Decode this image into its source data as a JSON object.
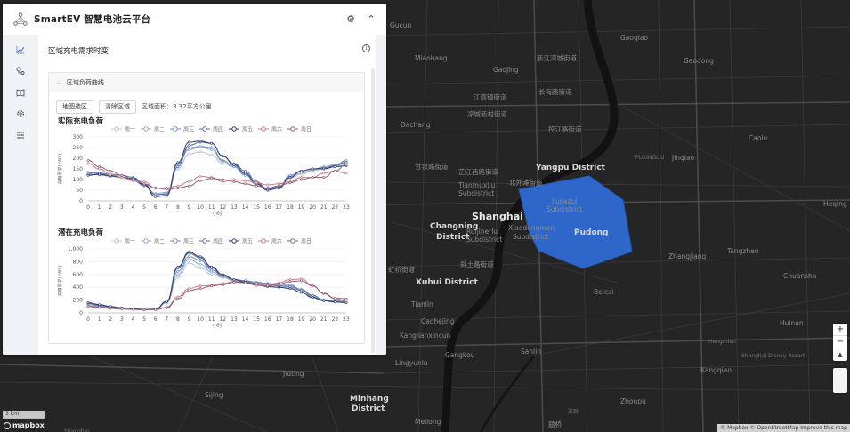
{
  "app": {
    "title": "SmartEV 智慧电池云平台"
  },
  "panel": {
    "section_title": "区域充电需求时变",
    "card_title": "区域负荷曲线",
    "buttons": {
      "select_area": "地图选区",
      "clear_area": "清除区域"
    },
    "area_text": "区域面积：3.32平方公里"
  },
  "nav_icons": [
    "chart-line-icon",
    "map-route-icon",
    "book-icon",
    "gear-icon",
    "sliders-icon"
  ],
  "colors": {
    "polygon": "#2f66c9",
    "map_bg": "#262626",
    "river": "#141414"
  },
  "map": {
    "labels": [
      {
        "t": "Gucun",
        "c": "sub"
      },
      {
        "t": "Gaoqiao",
        "c": "sub"
      },
      {
        "t": "Miaohang",
        "c": "sub"
      },
      {
        "t": "新江湾城街道",
        "c": "sub"
      },
      {
        "t": "Gaodong",
        "c": "sub"
      },
      {
        "t": "Gaojing",
        "c": "sub"
      },
      {
        "t": "江湾镇街道",
        "c": "sub"
      },
      {
        "t": "长海路街道",
        "c": "sub"
      },
      {
        "t": "凉城新村街道",
        "c": "sub"
      },
      {
        "t": "控江路街道",
        "c": "sub"
      },
      {
        "t": "Dachang",
        "c": "sub"
      },
      {
        "t": "Yangpu District",
        "c": "district"
      },
      {
        "t": "芷江西路街道",
        "c": "sub"
      },
      {
        "t": "北外滩街道",
        "c": "sub"
      },
      {
        "t": "Tianmuxilu",
        "c": "sub"
      },
      {
        "t": "Subdistrict",
        "c": "sub"
      },
      {
        "t": "甘泉路街道",
        "c": "sub"
      },
      {
        "t": "Shanghai",
        "c": "major"
      },
      {
        "t": "Changning",
        "c": "district"
      },
      {
        "t": "District",
        "c": "district"
      },
      {
        "t": "Ruijinerlu",
        "c": "sub"
      },
      {
        "t": "Subdistrict",
        "c": "sub"
      },
      {
        "t": "Xiaodongmen",
        "c": "sub"
      },
      {
        "t": "Subdistrict",
        "c": "sub"
      },
      {
        "t": "Lujiazui",
        "c": "sub"
      },
      {
        "t": "Subdistrict",
        "c": "sub"
      },
      {
        "t": "Pudong",
        "c": "district"
      },
      {
        "t": "斜土路街道",
        "c": "sub"
      },
      {
        "t": "虹桥街道",
        "c": "sub"
      },
      {
        "t": "Xuhui District",
        "c": "district"
      },
      {
        "t": "Beicai",
        "c": "sub"
      },
      {
        "t": "Tianlin",
        "c": "sub"
      },
      {
        "t": "Caohejing",
        "c": "sub"
      },
      {
        "t": "Kangjianxincun",
        "c": "sub"
      },
      {
        "t": "Gangkou",
        "c": "sub"
      },
      {
        "t": "Sanlin",
        "c": "sub"
      },
      {
        "t": "Lingyunlu",
        "c": "sub"
      },
      {
        "t": "Jiuting",
        "c": "sub"
      },
      {
        "t": "Sijing",
        "c": "sub"
      },
      {
        "t": "Minhang",
        "c": "district"
      },
      {
        "t": "District",
        "c": "district"
      },
      {
        "t": "Meilong",
        "c": "sub"
      },
      {
        "t": "Zhoupu",
        "c": "sub"
      },
      {
        "t": "Kangqiao",
        "c": "sub"
      },
      {
        "t": "Zhangjiang",
        "c": "sub"
      },
      {
        "t": "Tangzhen",
        "c": "sub"
      },
      {
        "t": "Chuansha",
        "c": "sub"
      },
      {
        "t": "Heqing",
        "c": "sub"
      },
      {
        "t": "Jinqiao",
        "c": "sub"
      },
      {
        "t": "Caolu",
        "c": "sub"
      },
      {
        "t": "Hengmian",
        "c": "small"
      },
      {
        "t": "Huinan",
        "c": "sub"
      },
      {
        "t": "Shanghai Disney Resort",
        "c": "small"
      },
      {
        "t": "PUXINGLIU",
        "c": "small"
      },
      {
        "t": "苏民",
        "c": "small"
      },
      {
        "t": "题桥",
        "c": "sub"
      },
      {
        "t": "Shanghai",
        "c": "small"
      }
    ],
    "scale": "3 km",
    "logo": "mapbox",
    "attribution": "© Mapbox © OpenStreetMap  Improve this map",
    "zoom_in": "+",
    "zoom_out": "−",
    "compass": "▲"
  },
  "chart_data": [
    {
      "type": "line",
      "title": "实际充电负荷",
      "xlabel": "小时",
      "ylabel": "充电需求(kWh)",
      "ylim": [
        0,
        300
      ],
      "yticks": [
        "300",
        "250",
        "200",
        "150",
        "100",
        "50",
        "0"
      ],
      "x": [
        0,
        1,
        2,
        3,
        4,
        5,
        6,
        7,
        8,
        9,
        10,
        11,
        12,
        13,
        14,
        15,
        16,
        17,
        18,
        19,
        20,
        21,
        22,
        23
      ],
      "legend": [
        "周一",
        "周二",
        "周三",
        "周四",
        "周五",
        "周六",
        "周日"
      ],
      "series": [
        {
          "name": "周一",
          "color": "#b9c3d6",
          "values": [
            130,
            128,
            120,
            112,
            105,
            80,
            30,
            30,
            150,
            220,
            230,
            215,
            175,
            160,
            125,
            75,
            60,
            65,
            105,
            125,
            140,
            150,
            160,
            175
          ]
        },
        {
          "name": "周二",
          "color": "#8ea8ce",
          "values": [
            135,
            125,
            118,
            110,
            95,
            70,
            35,
            40,
            170,
            250,
            255,
            240,
            185,
            165,
            125,
            80,
            55,
            70,
            115,
            130,
            145,
            160,
            170,
            185
          ]
        },
        {
          "name": "周三",
          "color": "#6f8ec6",
          "values": [
            125,
            122,
            115,
            110,
            100,
            75,
            28,
            35,
            175,
            240,
            255,
            250,
            190,
            160,
            120,
            85,
            50,
            60,
            120,
            140,
            150,
            150,
            165,
            190
          ]
        },
        {
          "name": "周四",
          "color": "#5b6fa4",
          "values": [
            130,
            130,
            125,
            120,
            110,
            80,
            30,
            30,
            160,
            260,
            275,
            270,
            210,
            175,
            140,
            90,
            55,
            65,
            110,
            140,
            150,
            155,
            165,
            180
          ]
        },
        {
          "name": "周五",
          "color": "#2e3a66",
          "values": [
            120,
            125,
            118,
            110,
            105,
            75,
            20,
            25,
            180,
            275,
            280,
            270,
            210,
            170,
            130,
            80,
            50,
            60,
            110,
            140,
            150,
            150,
            160,
            165
          ]
        },
        {
          "name": "周六",
          "color": "#c97a86",
          "values": [
            175,
            150,
            125,
            110,
            95,
            90,
            60,
            60,
            70,
            90,
            115,
            110,
            90,
            100,
            95,
            85,
            75,
            80,
            90,
            110,
            110,
            130,
            140,
            130
          ]
        },
        {
          "name": "周日",
          "color": "#8b5f7a",
          "values": [
            190,
            160,
            140,
            120,
            100,
            80,
            60,
            55,
            60,
            70,
            95,
            105,
            100,
            90,
            80,
            70,
            60,
            70,
            85,
            100,
            110,
            110,
            140,
            170
          ]
        }
      ]
    },
    {
      "type": "line",
      "title": "潜在充电负荷",
      "xlabel": "小时",
      "ylabel": "充电需求(kWh)",
      "ylim": [
        0,
        1000
      ],
      "yticks": [
        "1,000",
        "800",
        "600",
        "400",
        "200",
        "0"
      ],
      "x": [
        0,
        1,
        2,
        3,
        4,
        5,
        6,
        7,
        8,
        9,
        10,
        11,
        12,
        13,
        14,
        15,
        16,
        17,
        18,
        19,
        20,
        21,
        22,
        23
      ],
      "legend": [
        "周一",
        "周二",
        "周三",
        "周四",
        "周五",
        "周六",
        "周日"
      ],
      "series": [
        {
          "name": "周一",
          "color": "#b9c3d6",
          "values": [
            140,
            110,
            90,
            70,
            55,
            50,
            60,
            150,
            550,
            780,
            700,
            600,
            550,
            520,
            480,
            470,
            430,
            400,
            390,
            350,
            270,
            210,
            190,
            170
          ]
        },
        {
          "name": "周二",
          "color": "#8ea8ce",
          "values": [
            130,
            100,
            80,
            65,
            55,
            45,
            55,
            170,
            600,
            840,
            760,
            640,
            560,
            500,
            480,
            460,
            430,
            430,
            420,
            370,
            280,
            200,
            180,
            160
          ]
        },
        {
          "name": "周三",
          "color": "#6f8ec6",
          "values": [
            150,
            110,
            85,
            70,
            60,
            50,
            60,
            180,
            650,
            880,
            820,
            670,
            580,
            520,
            500,
            480,
            460,
            450,
            440,
            360,
            250,
            190,
            170,
            175
          ]
        },
        {
          "name": "周四",
          "color": "#5b6fa4",
          "values": [
            150,
            120,
            90,
            75,
            60,
            50,
            55,
            170,
            700,
            930,
            860,
            700,
            580,
            520,
            500,
            460,
            450,
            420,
            410,
            350,
            270,
            200,
            180,
            180
          ]
        },
        {
          "name": "周五",
          "color": "#2e3a66",
          "values": [
            160,
            130,
            100,
            80,
            65,
            55,
            60,
            180,
            720,
            950,
            880,
            720,
            600,
            520,
            480,
            440,
            410,
            400,
            380,
            320,
            240,
            190,
            170,
            160
          ]
        },
        {
          "name": "周六",
          "color": "#c97a86",
          "values": [
            110,
            90,
            75,
            65,
            55,
            50,
            55,
            90,
            250,
            380,
            420,
            430,
            460,
            490,
            470,
            440,
            430,
            470,
            520,
            530,
            430,
            300,
            220,
            190
          ]
        },
        {
          "name": "周日",
          "color": "#8b5f7a",
          "values": [
            100,
            85,
            70,
            60,
            55,
            50,
            50,
            80,
            220,
            350,
            380,
            420,
            440,
            480,
            470,
            430,
            420,
            450,
            490,
            500,
            420,
            310,
            230,
            220
          ]
        }
      ]
    }
  ]
}
